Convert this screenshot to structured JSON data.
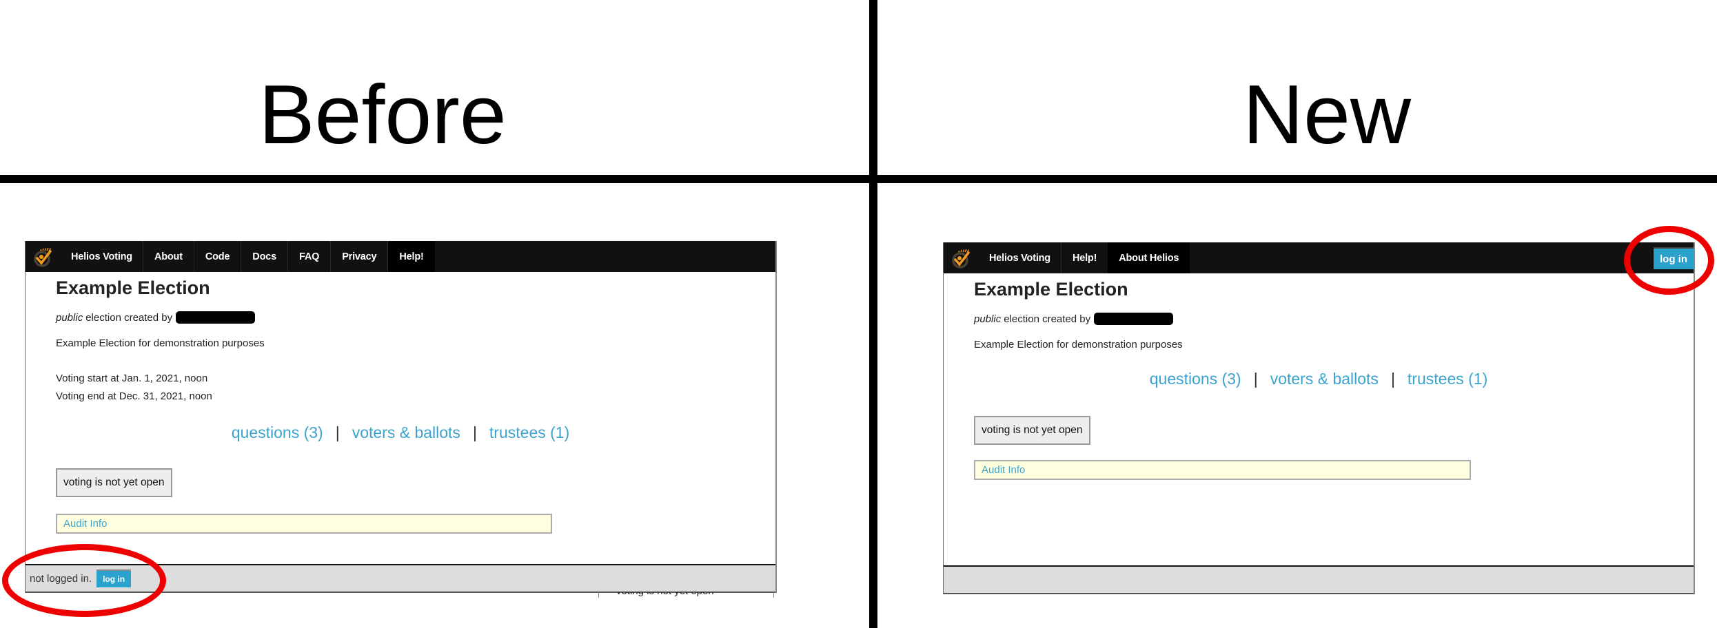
{
  "labels": {
    "before": "Before",
    "new": "New"
  },
  "colors": {
    "link": "#3ba3cd",
    "login_button": "#2ba2cc",
    "nav_background": "#111111",
    "highlight": "#ee0000",
    "audit_background": "#ffffe0"
  },
  "before_panel": {
    "nav": {
      "items": [
        "Helios Voting",
        "About",
        "Code",
        "Docs",
        "FAQ",
        "Privacy",
        "Help!"
      ],
      "active_item": "Help!"
    },
    "election": {
      "title": "Example Election",
      "visibility": "public",
      "created_by_text": "election created by",
      "description": "Example Election for demonstration purposes",
      "voting_start": "Voting start at Jan. 1, 2021, noon",
      "voting_end": "Voting end at Dec. 31, 2021, noon"
    },
    "links": {
      "questions": "questions (3)",
      "voters": "voters & ballots",
      "trustees": "trustees (1)",
      "separator": "|"
    },
    "vote_button": "voting is not yet open",
    "audit_info": "Audit Info",
    "footer": {
      "status": "not logged in.",
      "login": "log in"
    },
    "artifact_text": "voting is not yet open"
  },
  "new_panel": {
    "nav": {
      "items": [
        "Helios Voting",
        "Help!",
        "About Helios"
      ],
      "active_item": "About Helios",
      "login": "log in"
    },
    "election": {
      "title": "Example Election",
      "visibility": "public",
      "created_by_text": "election created by",
      "description": "Example Election for demonstration purposes"
    },
    "links": {
      "questions": "questions (3)",
      "voters": "voters & ballots",
      "trustees": "trustees (1)",
      "separator": "|"
    },
    "vote_button": "voting is not yet open",
    "audit_info": "Audit Info"
  }
}
